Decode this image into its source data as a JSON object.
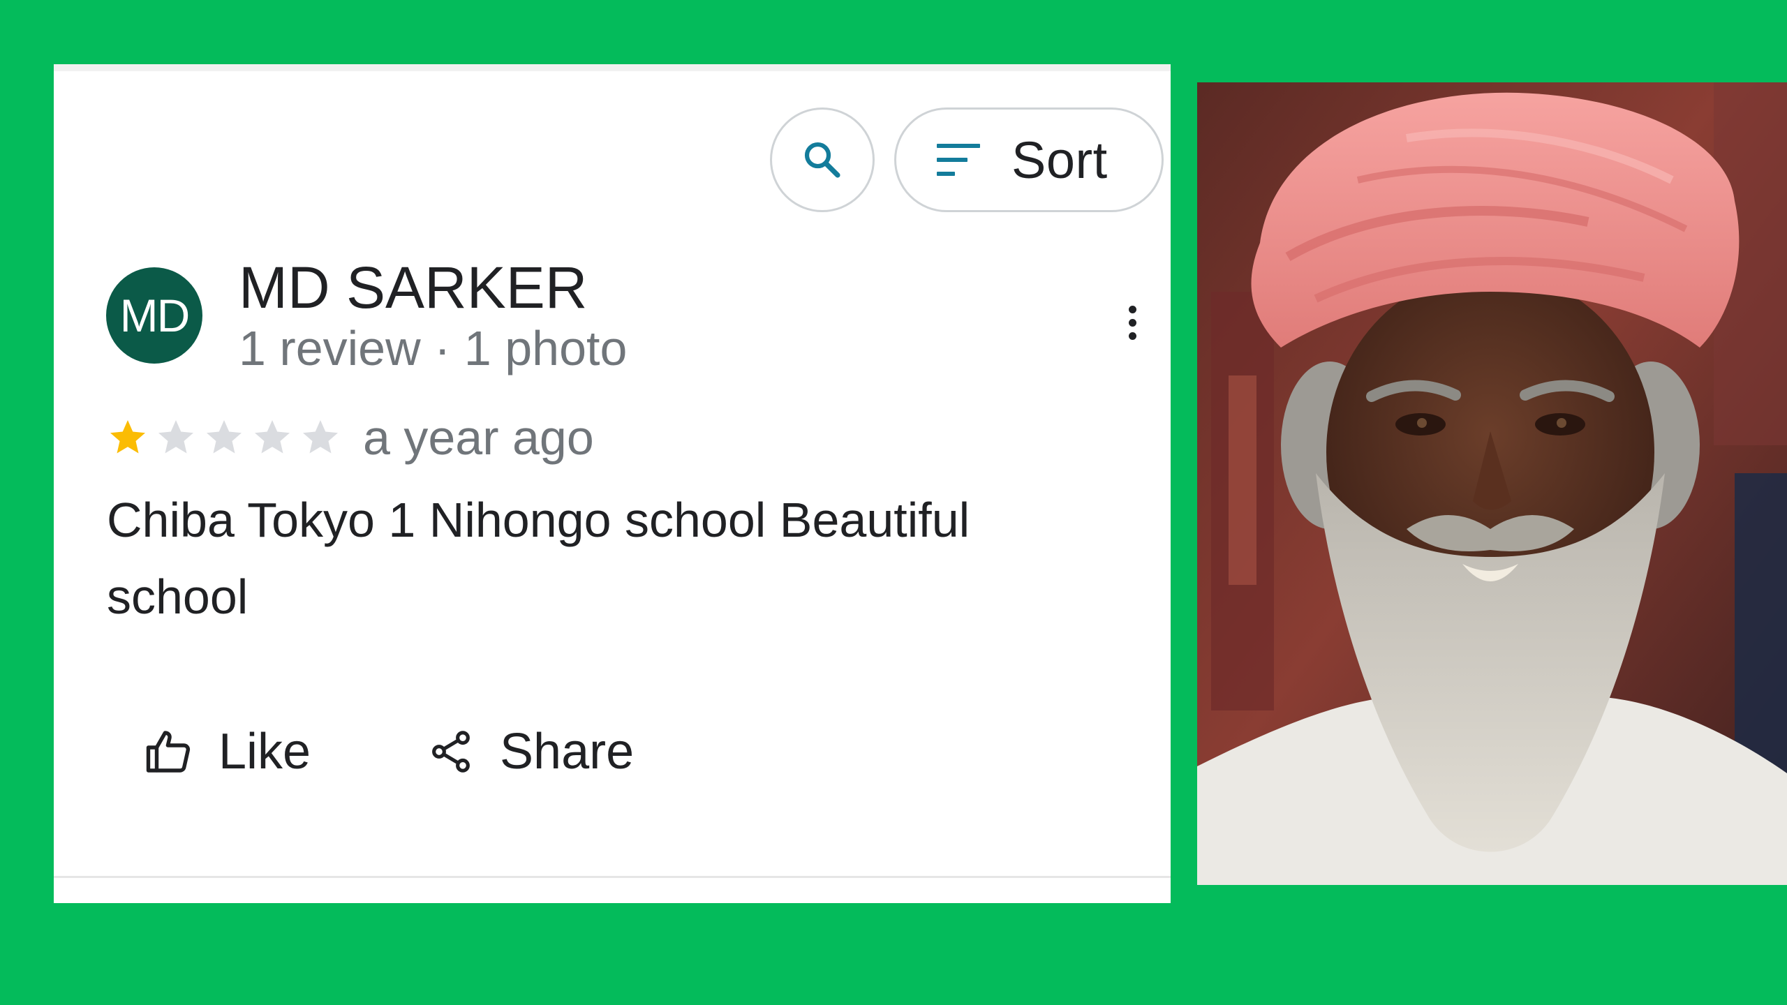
{
  "toolbar": {
    "search_icon": "search-icon",
    "sort_icon": "sort-icon",
    "sort_label": "Sort"
  },
  "review": {
    "avatar_initials": "MD",
    "avatar_color": "#0b5a48",
    "reviewer_name": "MD SARKER",
    "reviewer_meta": "1 review · 1 photo",
    "rating": 1,
    "rating_max": 5,
    "time": "a year ago",
    "text": "Chiba Tokyo 1 Nihongo school Beautiful school",
    "more_icon": "more-vert-icon"
  },
  "actions": {
    "like_label": "Like",
    "like_icon": "thumb-up-icon",
    "share_label": "Share",
    "share_icon": "share-icon"
  },
  "colors": {
    "background": "#04bb5b",
    "star_filled": "#fbbc04",
    "star_empty": "#dadce0",
    "accent": "#1a73e8",
    "search_icon": "#137c9b"
  },
  "photo": {
    "subject": "portrait of an elderly man with a pink turban and long grey beard"
  }
}
